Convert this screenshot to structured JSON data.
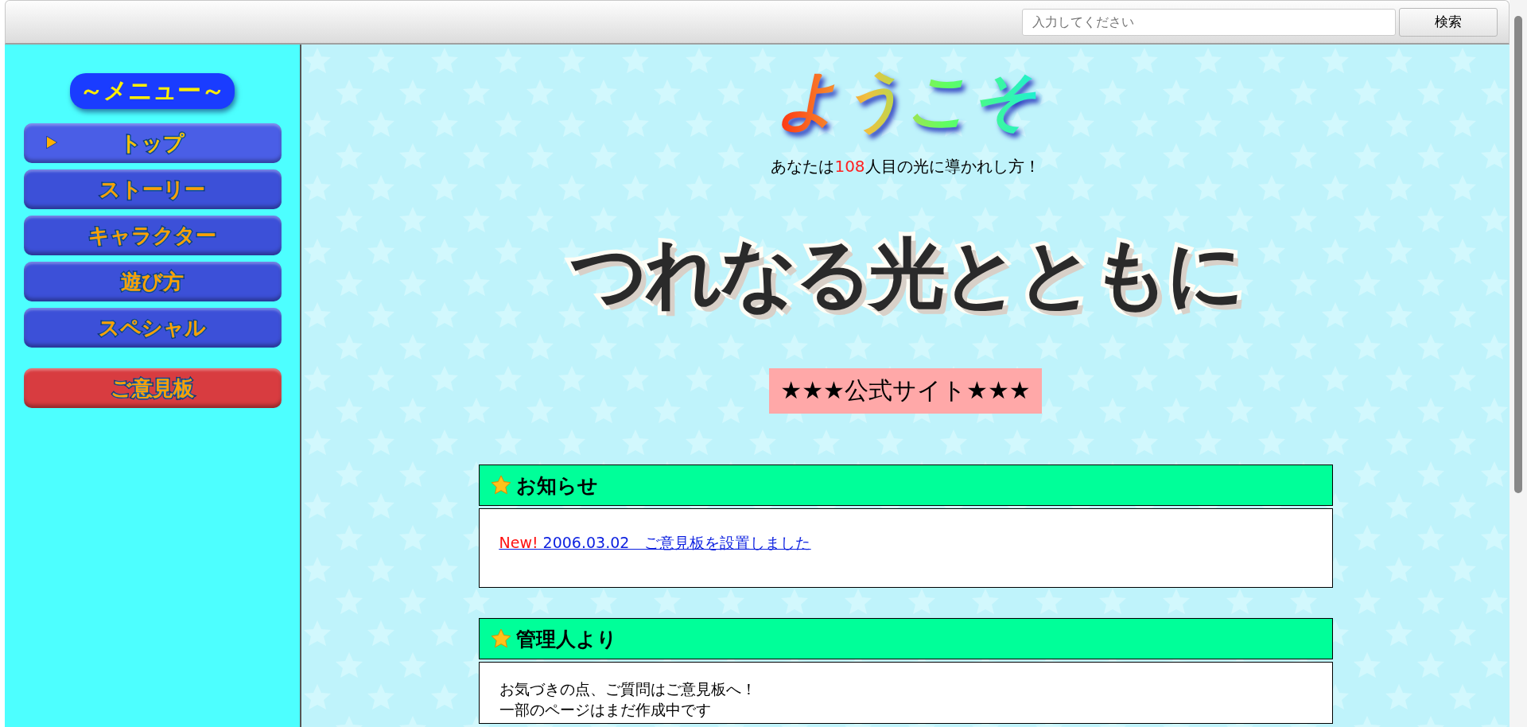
{
  "search": {
    "placeholder": "入力してください",
    "button": "検索"
  },
  "sidebar": {
    "title": "～メニュー～",
    "items": [
      {
        "label": "トップ",
        "kind": "main",
        "selected": true
      },
      {
        "label": "ストーリー",
        "kind": "main",
        "selected": false
      },
      {
        "label": "キャラクター",
        "kind": "main",
        "selected": false
      },
      {
        "label": "遊び方",
        "kind": "main",
        "selected": false
      },
      {
        "label": "スペシャル",
        "kind": "main",
        "selected": false
      },
      {
        "label": "ご意見板",
        "kind": "board",
        "selected": false
      }
    ]
  },
  "welcome": {
    "title": "ようこそ",
    "visitor_before": "あなたは",
    "visitor_count": "108",
    "visitor_after": "人目の光に導かれし方！"
  },
  "logo": {
    "text": "つれなる光とともに"
  },
  "badge": "★★★公式サイト★★★",
  "sections": [
    {
      "title": "お知らせ",
      "kind": "news",
      "items": [
        {
          "tag": "New!",
          "text": "2006.03.02　ご意見板を設置しました"
        }
      ]
    },
    {
      "title": "管理人より",
      "kind": "text",
      "lines": [
        "お気づきの点、ご質問はご意見板へ！",
        "一部のページはまだ作成中です"
      ]
    }
  ]
}
